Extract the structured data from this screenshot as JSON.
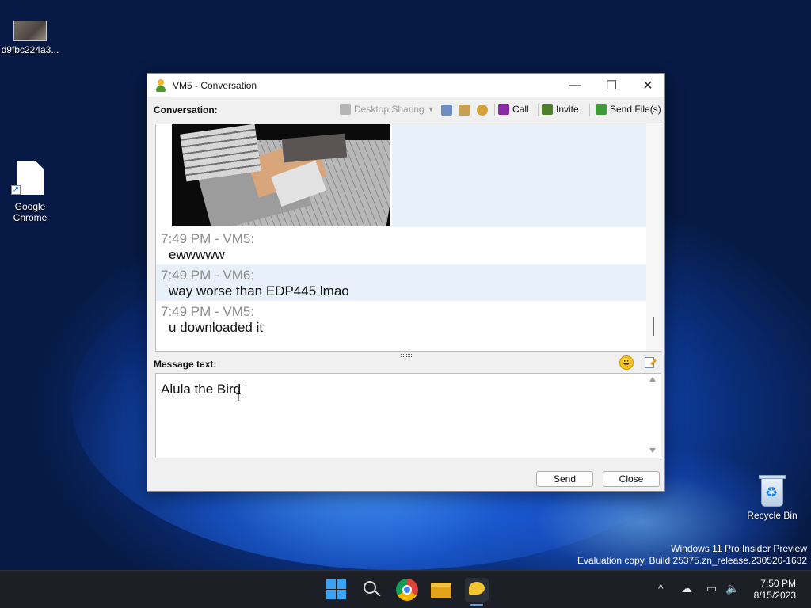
{
  "desktop": {
    "icons": [
      {
        "label": "d9fbc224a3..."
      },
      {
        "label": "Google Chrome"
      },
      {
        "label": "Recycle Bin"
      }
    ],
    "watermark": {
      "line1": "Windows 11 Pro Insider Preview",
      "line2": "Evaluation copy. Build 25375.zn_release.230520-1632"
    }
  },
  "window": {
    "title": "VM5 - Conversation",
    "controls": {
      "minimize": "—",
      "maximize": "☐",
      "close": "✕"
    },
    "toolbar": {
      "conversation_label": "Conversation:",
      "desktop_sharing": "Desktop Sharing",
      "call": "Call",
      "invite": "Invite",
      "send_files": "Send File(s)"
    },
    "messages": [
      {
        "header": "7:49 PM - VM5:",
        "text": "ewwwww"
      },
      {
        "header": "7:49 PM - VM6:",
        "text": "way worse than EDP445 lmao"
      },
      {
        "header": "7:49 PM - VM5:",
        "text": "u downloaded it"
      }
    ],
    "compose": {
      "label": "Message text:",
      "value": "Alula the Bird",
      "emoji": "😀"
    },
    "buttons": {
      "send": "Send",
      "close": "Close"
    }
  },
  "taskbar": {
    "time": "7:50 PM",
    "date": "8/15/2023",
    "tray_chevron": "^"
  },
  "colors": {
    "accent": "#3aa2f0",
    "message_highlight": "#e8f0fa",
    "timestamp_gray": "#8c8c8c",
    "taskbar": "#1c1f26"
  }
}
